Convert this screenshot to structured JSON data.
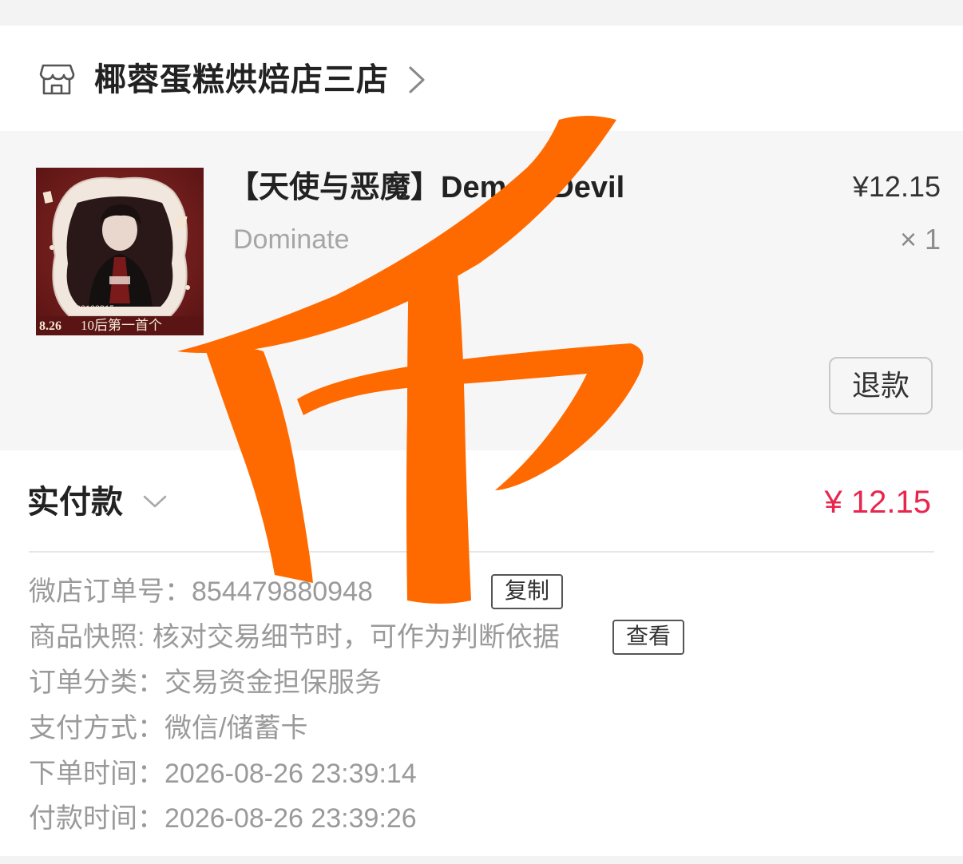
{
  "shop": {
    "icon": "store-icon",
    "name": "椰蓉蛋糕烘焙店三店"
  },
  "product": {
    "thumbnail": {
      "date": "8.26",
      "caption": "10后第一首个",
      "small_text": "20100915"
    },
    "title": "【天使与恶魔】Demon Devil",
    "variant": "Dominate",
    "price": "¥12.15",
    "quantity": "× 1",
    "refund_label": "退款"
  },
  "payment": {
    "paid_label": "实付款",
    "paid_amount": "¥ 12.15",
    "accent_color": "#e8264c"
  },
  "order_info": {
    "order_no_label": "微店订单号：",
    "order_no_value": "854479880948",
    "copy_label": "复制",
    "snapshot_label": "商品快照:",
    "snapshot_value": "核对交易细节时，可作为判断依据",
    "view_label": "查看",
    "category_label": "订单分类：",
    "category_value": "交易资金担保服务",
    "pay_method_label": "支付方式：",
    "pay_method_value": "微信/储蓄卡",
    "order_time_label": "下单时间：",
    "order_time_value": "2026-08-26 23:39:14",
    "pay_time_label": "付款时间：",
    "pay_time_value": "2026-08-26 23:39:26"
  },
  "overlay": {
    "stroke_color": "#ff6a00"
  }
}
